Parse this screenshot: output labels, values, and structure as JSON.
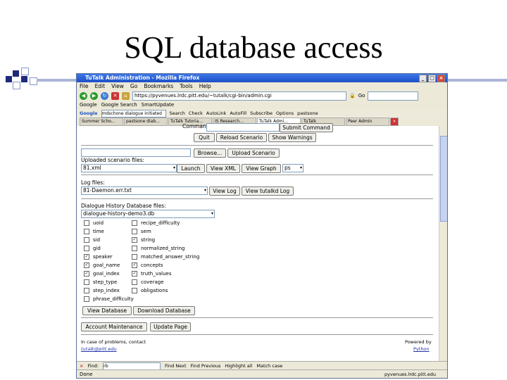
{
  "slide": {
    "title": "SQL database access"
  },
  "window": {
    "title": "TuTalk Administration - Mozilla Firefox",
    "controls": [
      "_",
      "□",
      "×"
    ],
    "menu": [
      "File",
      "Edit",
      "View",
      "Go",
      "Bookmarks",
      "Tools",
      "Help"
    ],
    "url": "https://pyvenues.lrdc.pitt.edu/~tutalk/cgi-bin/admin.cgi",
    "go_label": "Go",
    "bookmarks": [
      "Google",
      "Google Search",
      "SmartUpdate"
    ],
    "google_toolbar": {
      "logo": "Google",
      "query": "mdschone dialogue initiated",
      "items": [
        "Search",
        "Check",
        "AutoLink",
        "AutoFill",
        "Subscribe",
        "Options",
        "pastsone"
      ]
    },
    "tabs": [
      "Summer Scho...",
      "pastsone diab...",
      "TuTalk Tutoria...",
      "IS Research...",
      "TuTalk Admi...",
      "TuTalk",
      "Peer Admin"
    ],
    "active_tab_index": 4,
    "tab_close": "×",
    "status": "Done",
    "status_host": "pyvenues.lrdc.pitt.edu"
  },
  "page": {
    "command_label": "Command:",
    "submit_command": "Submit Command",
    "buttons_row1": [
      "Quit",
      "Reload Scenario",
      "Show Warnings"
    ],
    "browse": "Browse...",
    "upload": "Upload Scenario",
    "uploaded_label": "Uploaded scenario files:",
    "scenario_value": "81.xml",
    "launch": "Launch",
    "view_xml": "View XML",
    "view_graph": "View Graph",
    "graph_format": "ps",
    "log_label": "Log files:",
    "log_value": "81-Daemon.err.txt",
    "view_log": "View Log",
    "view_tutalkd_log": "View tutalkd Log",
    "dh_label": "Dialogue History Database files:",
    "dh_value": "dialogue-history-demo3.db",
    "columns_left": [
      {
        "label": "uoid",
        "checked": false
      },
      {
        "label": "time",
        "checked": false
      },
      {
        "label": "sid",
        "checked": false
      },
      {
        "label": "gid",
        "checked": false
      },
      {
        "label": "speaker",
        "checked": true
      },
      {
        "label": "goal_name",
        "checked": true
      },
      {
        "label": "goal_index",
        "checked": true
      },
      {
        "label": "step_type",
        "checked": false
      },
      {
        "label": "step_index",
        "checked": false
      },
      {
        "label": "phrase_difficulty",
        "checked": false
      }
    ],
    "columns_right": [
      {
        "label": "recipe_difficulty",
        "checked": false
      },
      {
        "label": "sem",
        "checked": false
      },
      {
        "label": "string",
        "checked": true
      },
      {
        "label": "normalized_string",
        "checked": false
      },
      {
        "label": "matched_answer_string",
        "checked": false
      },
      {
        "label": "concepts",
        "checked": true
      },
      {
        "label": "truth_values",
        "checked": true
      },
      {
        "label": "coverage",
        "checked": false
      },
      {
        "label": "obligations",
        "checked": false
      }
    ],
    "check_mark": "✓",
    "view_database": "View Database",
    "download_database": "Download Database",
    "account_maintenance": "Account Maintenance",
    "update_page": "Update Page",
    "footer_left_1": "In case of problems, contact",
    "footer_left_2": "tutalk@pitt.edu",
    "footer_right_1": "Powered by",
    "footer_right_2": "Python"
  },
  "findbar": {
    "close": "×",
    "label": "Find:",
    "value": "rb",
    "find_next": "Find Next",
    "find_previous": "Find Previous",
    "highlight": "Highlight all",
    "match_case": "Match case"
  }
}
